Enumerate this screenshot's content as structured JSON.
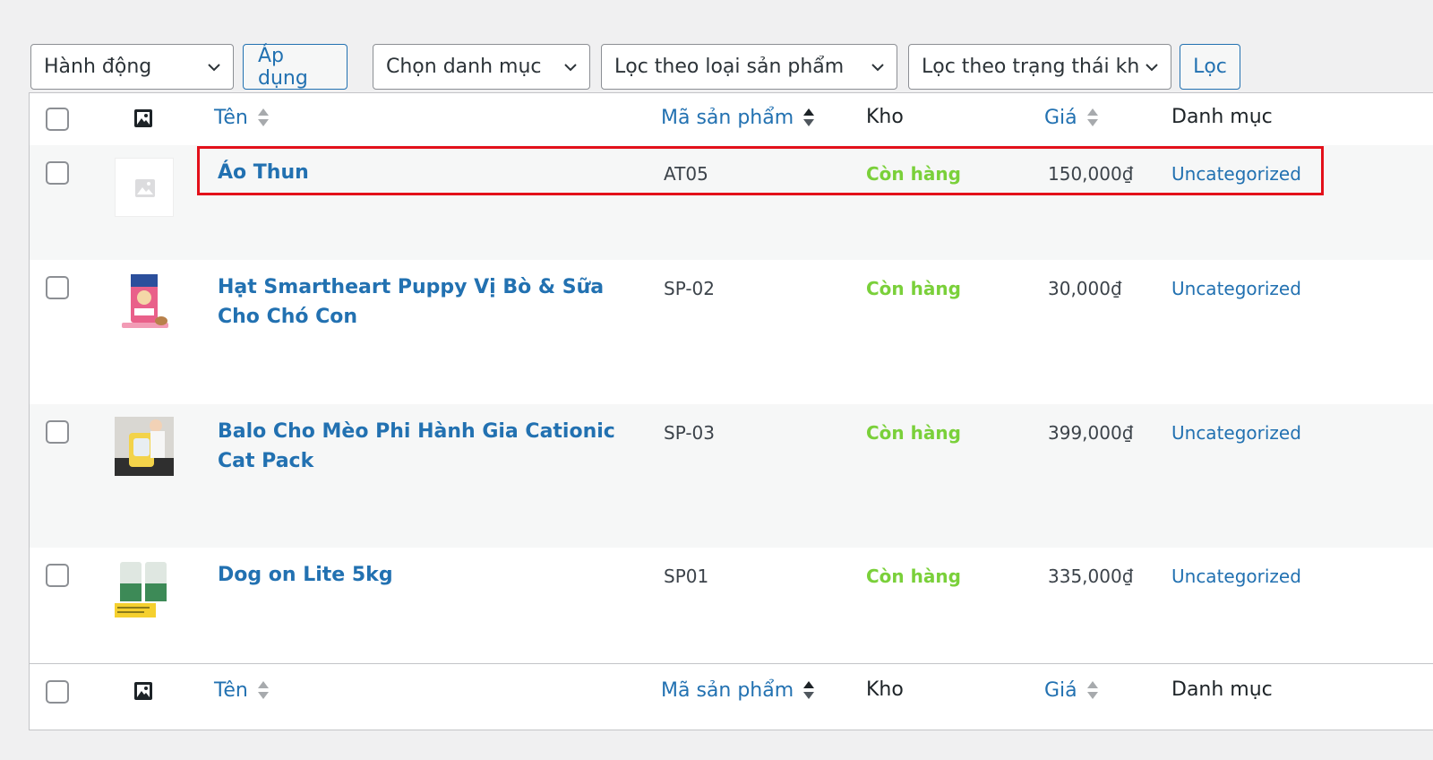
{
  "toolbar": {
    "bulk_action": "Hành động",
    "apply": "Áp dụng",
    "category": "Chọn danh mục",
    "product_type": "Lọc theo loại sản phẩm",
    "stock_status": "Lọc theo trạng thái kho",
    "filter": "Lọc"
  },
  "columns": {
    "name": "Tên",
    "sku": "Mã sản phẩm",
    "stock": "Kho",
    "price": "Giá",
    "category": "Danh mục"
  },
  "products": [
    {
      "name": "Áo Thun",
      "sku": "AT05",
      "stock": "Còn hàng",
      "price": "150,000₫",
      "category": "Uncategorized",
      "thumb": "placeholder"
    },
    {
      "name": "Hạt Smartheart Puppy Vị Bò & Sữa Cho Chó Con",
      "sku": "SP-02",
      "stock": "Còn hàng",
      "price": "30,000₫",
      "category": "Uncategorized",
      "thumb": "dog-food-bag"
    },
    {
      "name": "Balo Cho Mèo Phi Hành Gia Cationic Cat Pack",
      "sku": "SP-03",
      "stock": "Còn hàng",
      "price": "399,000₫",
      "category": "Uncategorized",
      "thumb": "cat-backpack"
    },
    {
      "name": "Dog on Lite 5kg",
      "sku": "SP01",
      "stock": "Còn hàng",
      "price": "335,000₫",
      "category": "Uncategorized",
      "thumb": "dog-food-bags"
    }
  ],
  "colors": {
    "link": "#2271b1",
    "in_stock": "#7ad03a",
    "highlight": "#e3101a"
  }
}
